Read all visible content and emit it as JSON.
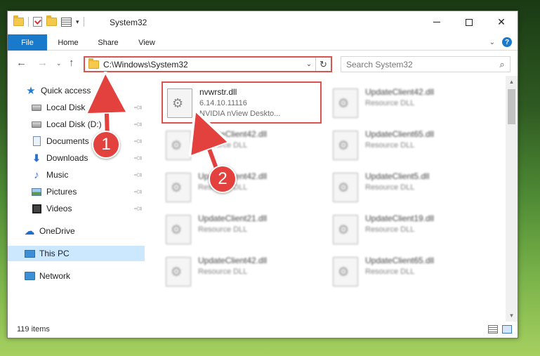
{
  "window": {
    "title": "System32"
  },
  "ribbon": {
    "tabs": [
      "File",
      "Home",
      "Share",
      "View"
    ],
    "help_label": "?"
  },
  "nav": {
    "back": "←",
    "forward": "→",
    "recent": "⌄",
    "up": "↑",
    "address": "C:\\Windows\\System32",
    "search_placeholder": "Search System32"
  },
  "sidebar": {
    "items": [
      {
        "label": "Quick access",
        "icon": "star-icon",
        "pinned": false
      },
      {
        "label": "Local Disk (C:)",
        "icon": "disk-icon",
        "pinned": true
      },
      {
        "label": "Local Disk (D:)",
        "icon": "disk-icon",
        "pinned": true
      },
      {
        "label": "Documents",
        "icon": "document-icon",
        "pinned": true
      },
      {
        "label": "Downloads",
        "icon": "download-icon",
        "pinned": true
      },
      {
        "label": "Music",
        "icon": "music-icon",
        "pinned": true
      },
      {
        "label": "Pictures",
        "icon": "pictures-icon",
        "pinned": true
      },
      {
        "label": "Videos",
        "icon": "video-icon",
        "pinned": true
      },
      {
        "label": "OneDrive",
        "icon": "cloud-icon",
        "pinned": false
      },
      {
        "label": "This PC",
        "icon": "pc-icon",
        "pinned": false,
        "selected": true
      },
      {
        "label": "Network",
        "icon": "network-icon",
        "pinned": false
      }
    ]
  },
  "files": [
    {
      "name": "nvwrstr.dll",
      "line2": "6.14.10.11116",
      "line3": "NVIDIA nView Deskto...",
      "highlighted": true
    },
    {
      "name": "UpdateClient42.dll",
      "line2": "Resource DLL"
    },
    {
      "name": "UpdateClient42.dll",
      "line2": "Resource DLL"
    },
    {
      "name": "UpdateClient65.dll",
      "line2": "Resource DLL"
    },
    {
      "name": "UpdateClient42.dll",
      "line2": "Resource DLL"
    },
    {
      "name": "UpdateClient5.dll",
      "line2": "Resource DLL"
    },
    {
      "name": "UpdateClient21.dll",
      "line2": "Resource DLL"
    },
    {
      "name": "UpdateClient19.dll",
      "line2": "Resource DLL"
    },
    {
      "name": "UpdateClient42.dll",
      "line2": "Resource DLL"
    },
    {
      "name": "UpdateClient65.dll",
      "line2": "Resource DLL"
    }
  ],
  "status": {
    "item_count": "119 items"
  },
  "annotations": {
    "step1": "1",
    "step2": "2",
    "color": "#e2413d"
  }
}
